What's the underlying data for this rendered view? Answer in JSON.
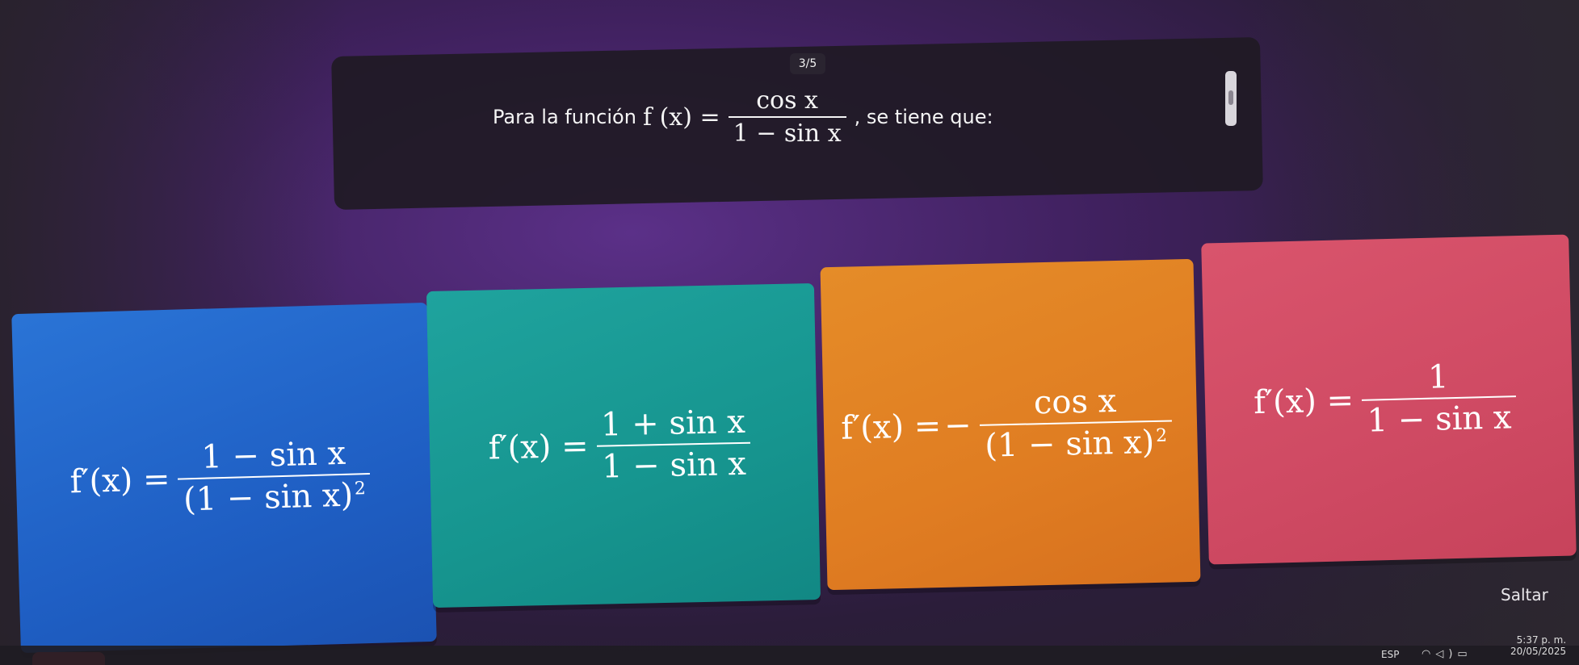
{
  "quiz": {
    "counter": "3/5",
    "question": {
      "prefix": "Para la función",
      "fn_lhs": "f (x) =",
      "fn_num": "cos x",
      "fn_den": "1 − sin x",
      "suffix": ", se tiene que:"
    },
    "options": [
      {
        "color": "#1f5fc4",
        "lhs": "f′(x) =",
        "num": "1 − sin x",
        "den": "(1 − sin x)",
        "den_exp": "2",
        "sign": ""
      },
      {
        "color": "#16958f",
        "lhs": "f′(x) =",
        "num": "1 + sin x",
        "den": "1 − sin x",
        "den_exp": "",
        "sign": ""
      },
      {
        "color": "#e07d22",
        "lhs": "f′(x) =",
        "num": "cos x",
        "den": "(1 − sin x)",
        "den_exp": "2",
        "sign": "−"
      },
      {
        "color": "#cf4a63",
        "lhs": "f′(x) =",
        "num": "1",
        "den": "1 − sin x",
        "den_exp": "",
        "sign": ""
      }
    ],
    "skip_label": "Saltar"
  },
  "taskbar": {
    "language": "ESP",
    "icons": [
      "wifi-icon",
      "volume-icon",
      "battery-icon"
    ],
    "time": "5:37 p. m.",
    "date": "20/05/2025"
  }
}
